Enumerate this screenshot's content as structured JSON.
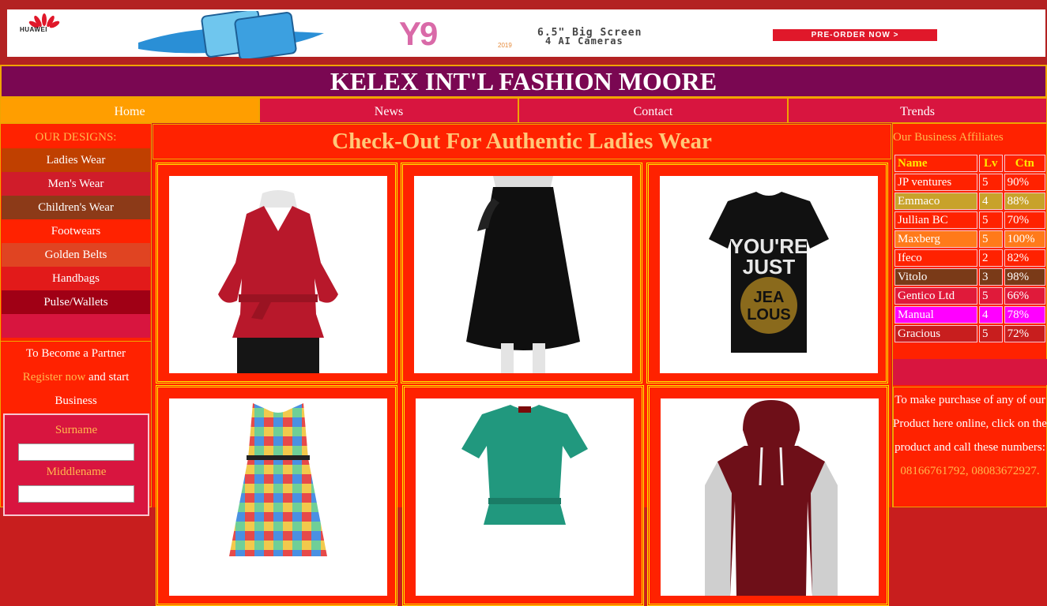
{
  "banner": {
    "brand": "HUAWEI",
    "model": "Y9",
    "year": "2019",
    "line1": "6.5\" Big Screen",
    "line2": "4 AI Cameras",
    "cta": "PRE-ORDER NOW >"
  },
  "site_title": "KELEX INT'L FASHION MOORE",
  "nav": [
    {
      "label": "Home"
    },
    {
      "label": "News"
    },
    {
      "label": "Contact"
    },
    {
      "label": "Trends"
    }
  ],
  "designs": {
    "heading": "OUR DESIGNS:",
    "items": [
      {
        "label": "Ladies Wear",
        "color": "#c04000"
      },
      {
        "label": "Men's Wear",
        "color": "#d01c2a"
      },
      {
        "label": "Children's Wear",
        "color": "#8c3a18"
      },
      {
        "label": "Footwears",
        "color": "#ff2200"
      },
      {
        "label": "Golden Belts",
        "color": "#e04422"
      },
      {
        "label": "Handbags",
        "color": "#e21a1a"
      },
      {
        "label": "Pulse/Wallets",
        "color": "#a00015"
      }
    ]
  },
  "partner": {
    "line1": "To Become a Partner",
    "link": "Register now",
    "line2": " and start",
    "line3": "Business",
    "form": {
      "surname_label": "Surname",
      "middlename_label": "Middlename"
    }
  },
  "main": {
    "title": "Check-Out For Authentic Ladies Wear",
    "products": [
      {
        "name": "red-wrap-blouse"
      },
      {
        "name": "black-skirt"
      },
      {
        "name": "black-graphic-tee"
      },
      {
        "name": "checkered-dress"
      },
      {
        "name": "green-top"
      },
      {
        "name": "maroon-hoodie"
      }
    ]
  },
  "affiliates": {
    "heading": "Our Business Affiliates",
    "headers": [
      "Name",
      "Lv",
      "Ctn"
    ],
    "rows": [
      {
        "name": "JP ventures",
        "lv": "5",
        "ctn": "90%",
        "color": "#ff2200"
      },
      {
        "name": "Emmaco",
        "lv": "4",
        "ctn": "88%",
        "color": "#c8a22a"
      },
      {
        "name": "Jullian BC",
        "lv": "5",
        "ctn": "70%",
        "color": "#ff2200"
      },
      {
        "name": "Maxberg",
        "lv": "5",
        "ctn": "100%",
        "color": "#ff7a1a"
      },
      {
        "name": "Ifeco",
        "lv": "2",
        "ctn": "82%",
        "color": "#ff2200"
      },
      {
        "name": "Vitolo",
        "lv": "3",
        "ctn": "98%",
        "color": "#7a3a18"
      },
      {
        "name": "Gentico Ltd",
        "lv": "5",
        "ctn": "66%",
        "color": "#e01a3a"
      },
      {
        "name": "Manual",
        "lv": "4",
        "ctn": "78%",
        "color": "#ff00ff"
      },
      {
        "name": "Gracious",
        "lv": "5",
        "ctn": "72%",
        "color": "#c81e1e"
      }
    ]
  },
  "purchase": {
    "text": "To make purchase of any of our Product here online, click on the product and call these numbers: ",
    "phones": "08166761792, 08083672927."
  }
}
